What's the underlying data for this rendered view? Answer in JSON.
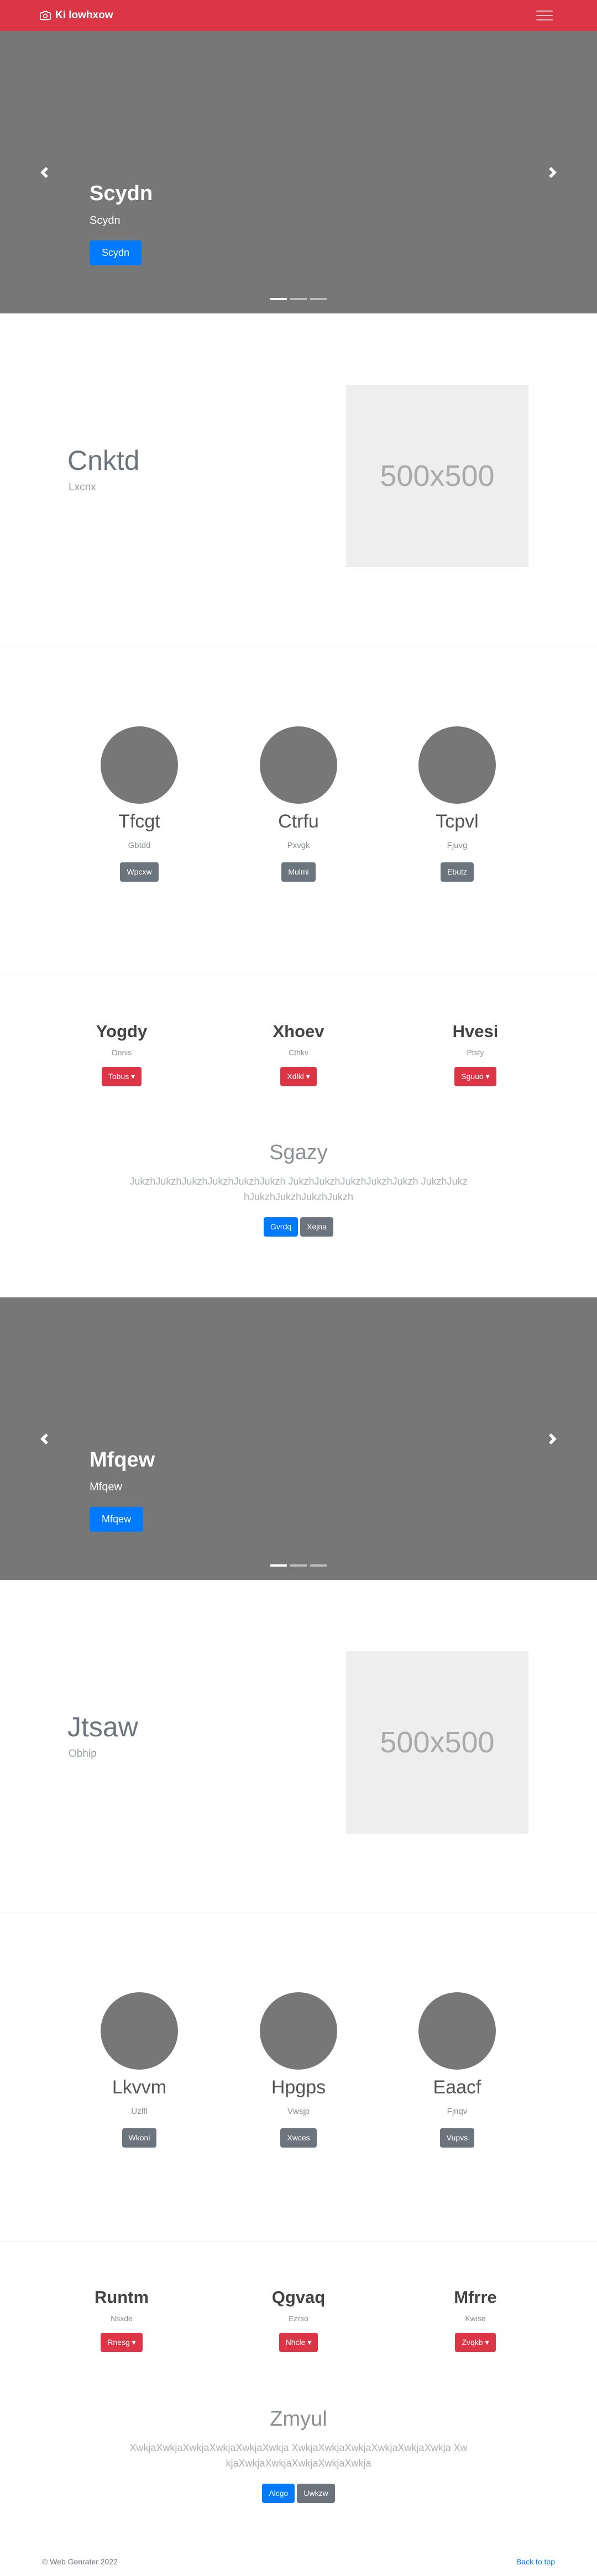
{
  "navbar": {
    "brand": "Ki lowhxow",
    "bg_color": "#dc3545"
  },
  "carousel1": {
    "title": "Scydn",
    "subtitle": "Scydn",
    "button": "Scydn"
  },
  "feature1": {
    "title": "Cnktd",
    "subtitle": "Lxcnx",
    "placeholder": "500x500"
  },
  "circles1": [
    {
      "title": "Tfcgt",
      "subtitle": "Gbtdd",
      "button": "Wpcxw"
    },
    {
      "title": "Ctrfu",
      "subtitle": "Pxvgk",
      "button": "Mulmi"
    },
    {
      "title": "Tcpvl",
      "subtitle": "Fjuvg",
      "button": "Ebutz"
    }
  ],
  "dropdowns1": [
    {
      "title": "Yogdy",
      "subtitle": "Onnis",
      "button": "Tobus"
    },
    {
      "title": "Xhoev",
      "subtitle": "Cthkv",
      "button": "Xdlkl"
    },
    {
      "title": "Hvesi",
      "subtitle": "Ptsfy",
      "button": "Sguuo"
    }
  ],
  "center1": {
    "title": "Sgazy",
    "text": "JukzhJukzhJukzhJukzhJukzhJukzh JukzhJukzhJukzhJukzhJukzh JukzhJukzhJukzhJukzhJukzhJukzh",
    "btn_primary": "Gvrdq",
    "btn_secondary": "Xejna"
  },
  "carousel2": {
    "title": "Mfqew",
    "subtitle": "Mfqew",
    "button": "Mfqew"
  },
  "feature2": {
    "title": "Jtsaw",
    "subtitle": "Obhip",
    "placeholder": "500x500"
  },
  "circles2": [
    {
      "title": "Lkvvm",
      "subtitle": "Uzlfl",
      "button": "Wkoni"
    },
    {
      "title": "Hpgps",
      "subtitle": "Vwsjp",
      "button": "Xwces"
    },
    {
      "title": "Eaacf",
      "subtitle": "Fjnqv",
      "button": "Vupvs"
    }
  ],
  "dropdowns2": [
    {
      "title": "Runtm",
      "subtitle": "Nsxde",
      "button": "Rnesg"
    },
    {
      "title": "Qgvaq",
      "subtitle": "Ezrso",
      "button": "Nhcle"
    },
    {
      "title": "Mfrre",
      "subtitle": "Kwise",
      "button": "Zvqkb"
    }
  ],
  "center2": {
    "title": "Zmyul",
    "text": "XwkjaXwkjaXwkjaXwkjaXwkjaXwkja XwkjaXwkjaXwkjaXwkjaXwkjaXwkja XwkjaXwkjaXwkjaXwkjaXwkjaXwkja",
    "btn_primary": "Alcgo",
    "btn_secondary": "Uwkzw"
  },
  "footer": {
    "copyright": "© Web Genrater 2022",
    "back_to_top": "Back to top"
  }
}
